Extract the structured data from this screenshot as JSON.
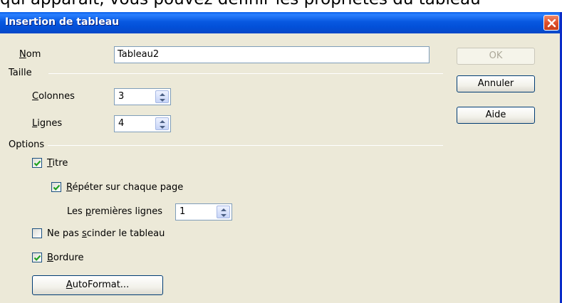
{
  "background_text": "qui apparaît, vous pouvez définir les propriétés du tableau",
  "dialog": {
    "title": "Insertion de tableau",
    "name": {
      "label_access": "N",
      "label_rest": "om",
      "value": "Tableau2"
    },
    "size_section": "Taille",
    "columns": {
      "label_access": "C",
      "label_rest": "olonnes",
      "value": "3"
    },
    "rows": {
      "label_access": "L",
      "label_rest": "ignes",
      "value": "4"
    },
    "options_section": "Options",
    "title_option": {
      "label_access": "T",
      "label_rest": "itre",
      "checked": true
    },
    "repeat_option": {
      "label_access": "R",
      "label_rest": "épéter sur chaque page",
      "checked": true
    },
    "first_lines": {
      "label_pre": "Les ",
      "label_access": "p",
      "label_rest": "remières lignes",
      "value": "1"
    },
    "no_split_option": {
      "label_pre": "Ne pas ",
      "label_access": "s",
      "label_rest": "cinder le tableau",
      "checked": false
    },
    "border_option": {
      "label_access": "B",
      "label_rest": "ordure",
      "checked": true
    },
    "autoformat_button": {
      "label_access": "A",
      "label_rest": "utoFormat..."
    },
    "ok_button": "OK",
    "cancel_button": "Annuler",
    "help_button": "Aide"
  },
  "colors": {
    "titlebar": "#0350d8",
    "dialog_bg": "#ece9d8",
    "close_button": "#e0502a",
    "checkmark": "#21a121"
  }
}
